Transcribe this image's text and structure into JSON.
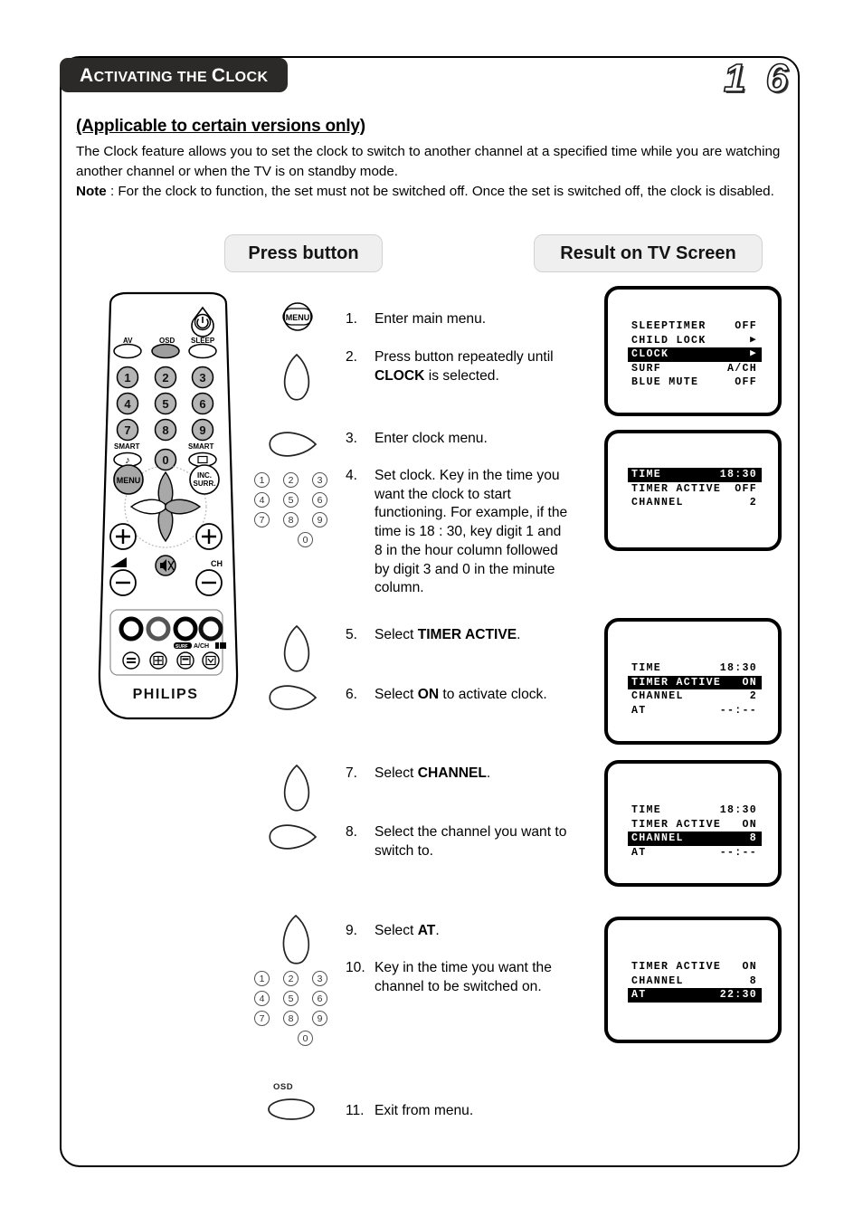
{
  "header": {
    "title_first": "A",
    "title_rest1": "CTIVATING THE ",
    "title_c": "C",
    "title_rest2": "LOCK",
    "title_full": "Activating the Clock",
    "page_number": "1 6"
  },
  "intro": {
    "subtitle": "(Applicable to certain versions only)",
    "paragraph1": "The Clock feature allows you to set the clock to switch to another channel at a specified time while you are watching another channel or when the TV is on standby mode.",
    "note_label": "Note",
    "note_text": " : For the clock to function, the set must not be switched off. Once the set is switched off, the clock is disabled."
  },
  "columns": {
    "press_button": "Press button",
    "result_on_tv": "Result on TV Screen"
  },
  "remote": {
    "brand": "PHILIPS",
    "labels": {
      "av": "AV",
      "osd": "OSD",
      "sleep": "SLEEP",
      "smart_left": "SMART",
      "smart_right": "SMART",
      "menu": "MENU",
      "inc_surr_1": "INC.",
      "inc_surr_2": "SURR.",
      "ch": "CH",
      "ach": "A/CH",
      "surf_tag": "SURF"
    },
    "digits": [
      "1",
      "2",
      "3",
      "4",
      "5",
      "6",
      "7",
      "8",
      "9",
      "0"
    ]
  },
  "steps": [
    {
      "num": "1.",
      "text": "Enter main menu.",
      "button": "menu-round"
    },
    {
      "num": "2.",
      "text": "Press button repeatedly until CLOCK is selected.",
      "text_pre": "Press button repeatedly until ",
      "text_bold": "CLOCK",
      "text_post": " is selected.",
      "button": "teardrop-down"
    },
    {
      "num": "3.",
      "text": "Enter clock menu.",
      "button": "teardrop-right"
    },
    {
      "num": "4.",
      "text": "Set clock. Key in the time you want the clock to start functioning. For example, if the time is 18 : 30, key digit 1 and 8 in the hour column followed by digit 3 and 0 in the minute column.",
      "button": "keypad"
    },
    {
      "num": "5.",
      "text": "Select TIMER ACTIVE.",
      "text_pre": "Select ",
      "text_bold": "TIMER ACTIVE",
      "text_post": ".",
      "button": "teardrop-down"
    },
    {
      "num": "6.",
      "text": "Select ON to activate clock.",
      "text_pre": "Select ",
      "text_bold": "ON",
      "text_post": " to activate clock.",
      "button": "teardrop-right"
    },
    {
      "num": "7.",
      "text": "Select CHANNEL.",
      "text_pre": "Select ",
      "text_bold": "CHANNEL",
      "text_post": ".",
      "button": "teardrop-down"
    },
    {
      "num": "8.",
      "text": "Select the channel you want to switch to.",
      "button": "teardrop-right"
    },
    {
      "num": "9.",
      "text": "Select AT.",
      "text_pre": "Select ",
      "text_bold": "AT",
      "text_post": ".",
      "button": "teardrop-down"
    },
    {
      "num": "10.",
      "text": "Key in the time you want the channel to be switched on.",
      "button": "keypad"
    },
    {
      "num": "11.",
      "text": "Exit from menu.",
      "button": "osd-ellipse",
      "button_label": "OSD"
    }
  ],
  "tv_screens": [
    {
      "id": "tv1",
      "lines": [
        {
          "label": "SLEEPTIMER",
          "value": "OFF",
          "highlight": false
        },
        {
          "label": "CHILD LOCK",
          "value": "▶",
          "highlight": false
        },
        {
          "label": "CLOCK",
          "value": "▶",
          "highlight": true
        },
        {
          "label": "SURF",
          "value": "A/CH",
          "highlight": false
        },
        {
          "label": "BLUE MUTE",
          "value": "OFF",
          "highlight": false
        }
      ]
    },
    {
      "id": "tv2",
      "lines": [
        {
          "label": "TIME",
          "value": "18:30",
          "highlight": true
        },
        {
          "label": "TIMER ACTIVE",
          "value": "OFF",
          "highlight": false
        },
        {
          "label": "CHANNEL",
          "value": "2",
          "highlight": false
        }
      ]
    },
    {
      "id": "tv3",
      "lines": [
        {
          "label": "TIME",
          "value": "18:30",
          "highlight": false
        },
        {
          "label": "TIMER ACTIVE",
          "value": "ON",
          "highlight": true
        },
        {
          "label": "CHANNEL",
          "value": "2",
          "highlight": false
        },
        {
          "label": "AT",
          "value": "--:--",
          "highlight": false
        }
      ]
    },
    {
      "id": "tv4",
      "lines": [
        {
          "label": "TIME",
          "value": "18:30",
          "highlight": false
        },
        {
          "label": "TIMER ACTIVE",
          "value": "ON",
          "highlight": false
        },
        {
          "label": "CHANNEL",
          "value": "8",
          "highlight": true
        },
        {
          "label": "AT",
          "value": "--:--",
          "highlight": false
        }
      ]
    },
    {
      "id": "tv5",
      "lines": [
        {
          "label": "TIMER ACTIVE",
          "value": "ON",
          "highlight": false
        },
        {
          "label": "CHANNEL",
          "value": "8",
          "highlight": false
        },
        {
          "label": "AT",
          "value": "22:30",
          "highlight": true
        }
      ]
    }
  ],
  "colors": {
    "title_bar": "#2b2a28",
    "pill_bg": "#efefef",
    "highlight_bg": "#000000",
    "button_gray": "#a8a8a8"
  }
}
